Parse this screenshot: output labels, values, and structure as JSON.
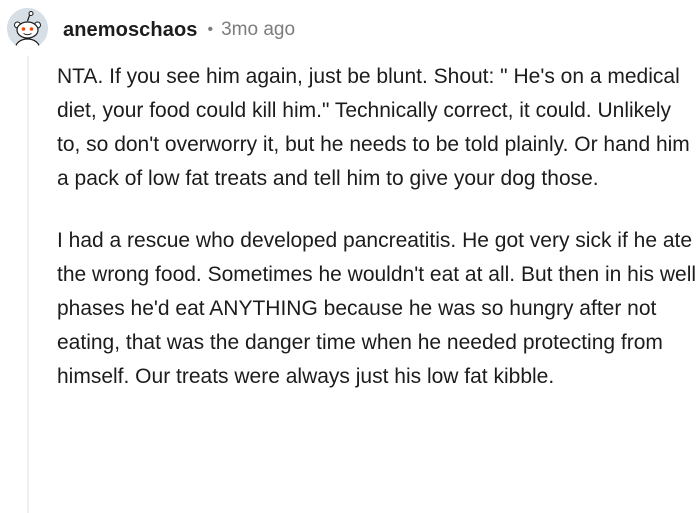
{
  "comment": {
    "username": "anemoschaos",
    "separator": "•",
    "timestamp": "3mo ago",
    "avatar_icon": "reddit-snoo-avatar-icon",
    "avatar_color": "#d7dfe6",
    "paragraphs": [
      "NTA. If you see him again, just be blunt. Shout: \" He's on a medical diet, your food could kill him.\" Technically correct, it could. Unlikely to, so don't overworry it, but he needs to be told plainly. Or hand him a pack of low fat treats and tell him to give your dog those.",
      "I had a rescue who developed pancreatitis. He got very sick if he ate the wrong food. Sometimes he wouldn't eat at all. But then in his well phases he'd eat ANYTHING because he was so hungry after not eating, that was the danger time when he needed protecting from himself. Our treats were always just his low fat kibble."
    ]
  }
}
